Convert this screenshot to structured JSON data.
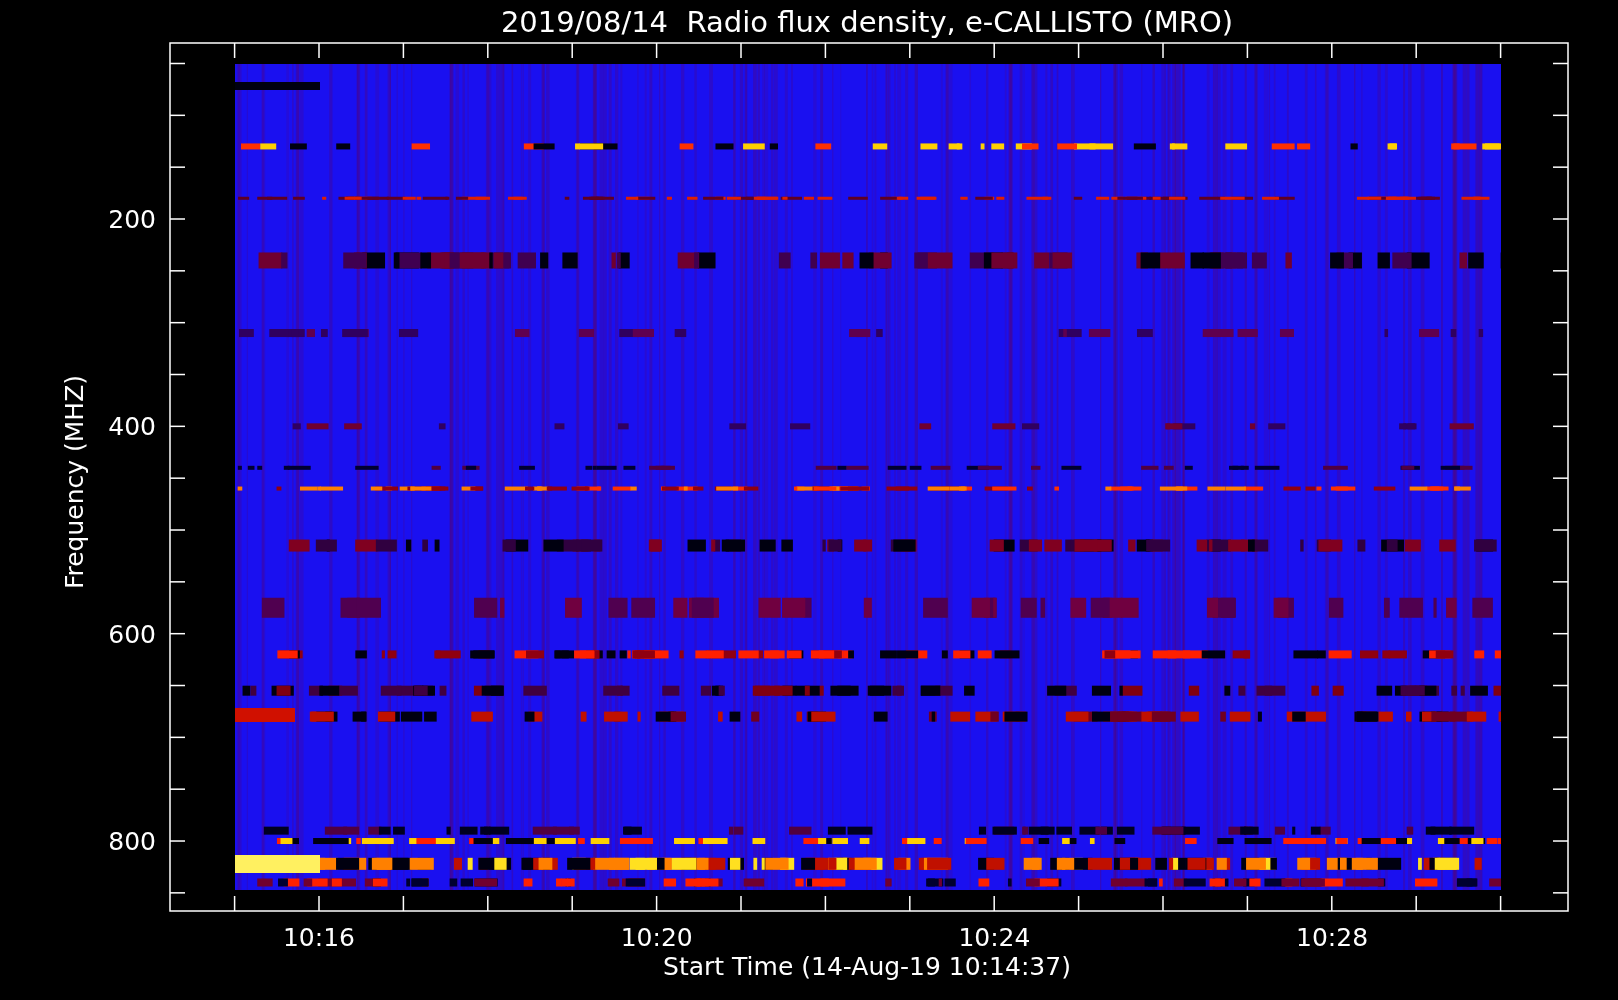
{
  "title": "2019/08/14  Radio flux density, e-CALLISTO (MRO)",
  "y_axis": {
    "label": "Frequency (MHZ)",
    "ticks": [
      "200",
      "400",
      "600",
      "800"
    ]
  },
  "x_axis": {
    "label": "Start Time (14-Aug-19 10:14:37)",
    "ticks": [
      "10:16",
      "10:20",
      "10:24",
      "10:28"
    ]
  }
}
